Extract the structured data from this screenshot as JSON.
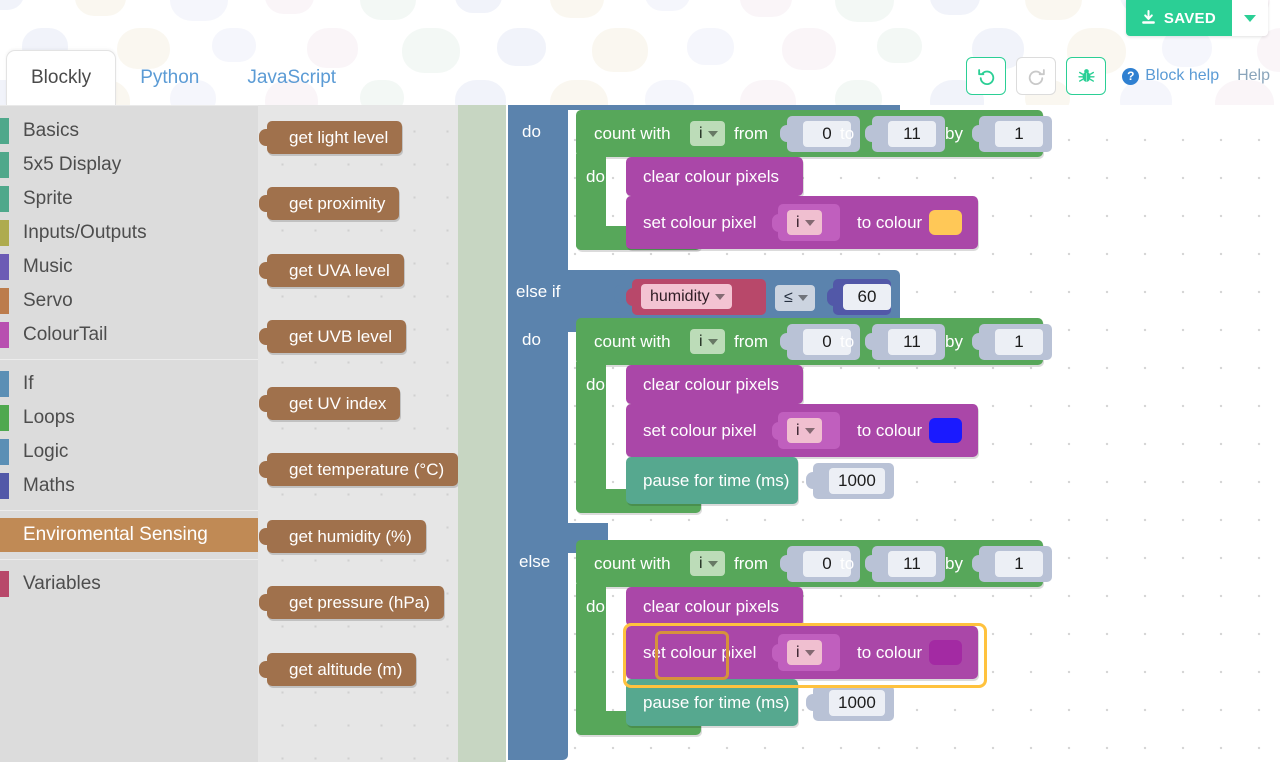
{
  "header": {
    "tabs": [
      {
        "label": "Blockly",
        "active": true
      },
      {
        "label": "Python",
        "active": false
      },
      {
        "label": "JavaScript",
        "active": false
      }
    ],
    "save_button": {
      "label": "SAVED",
      "icon": "download-icon",
      "color": "#2bcf95"
    },
    "save_dropdown_icon": "chevron-down-icon",
    "toolbar": [
      {
        "name": "undo-button",
        "icon": "undo-icon",
        "enabled": true
      },
      {
        "name": "redo-button",
        "icon": "redo-icon",
        "enabled": false
      },
      {
        "name": "debug-button",
        "icon": "bug-icon",
        "enabled": true
      }
    ],
    "block_help_label": "Block help",
    "help_label": "Help"
  },
  "toolbox": {
    "groups": [
      [
        {
          "label": "Basics",
          "color": "#4fa88b"
        },
        {
          "label": "5x5 Display",
          "color": "#4fa88b"
        },
        {
          "label": "Sprite",
          "color": "#4fa88b"
        },
        {
          "label": "Inputs/Outputs",
          "color": "#aeab4e"
        },
        {
          "label": "Music",
          "color": "#6c5bb5"
        },
        {
          "label": "Servo",
          "color": "#bc7c4c"
        },
        {
          "label": "ColourTail",
          "color": "#b84fb0"
        }
      ],
      [
        {
          "label": "If",
          "color": "#5b8fb5"
        },
        {
          "label": "Loops",
          "color": "#4fa84f"
        },
        {
          "label": "Logic",
          "color": "#5b8fb5"
        },
        {
          "label": "Maths",
          "color": "#5258a8"
        }
      ],
      [
        {
          "label": "Enviromental Sensing",
          "color": "#c08a55",
          "selected": true
        }
      ],
      [
        {
          "label": "Variables",
          "color": "#b8486a"
        }
      ]
    ]
  },
  "flyout": {
    "block_color": "#a0714c",
    "blocks": [
      {
        "label": "get light level"
      },
      {
        "label": "get proximity"
      },
      {
        "label": "get UVA level"
      },
      {
        "label": "get UVB level"
      },
      {
        "label": "get UV index"
      },
      {
        "label": "get temperature (°C)"
      },
      {
        "label": "get humidity (%)"
      },
      {
        "label": "get pressure (hPa)"
      },
      {
        "label": "get altitude (m)"
      }
    ]
  },
  "workspace": {
    "if_block": {
      "color": "#5b83ad",
      "branch1_label": "do",
      "elseif_label": "else if",
      "branch2_label": "do",
      "else_label": "else",
      "condition": {
        "variable": "humidity",
        "operator": "≤",
        "value": "60"
      }
    },
    "loop": {
      "color": "#57a75a",
      "count_with": "count with",
      "var": "i",
      "from_label": "from",
      "from_value": "0",
      "to_label": "to",
      "to_value": "11",
      "by_label": "by",
      "by_value": "1",
      "do_label": "do"
    },
    "colourtail": {
      "color": "#aa47a8",
      "clear_label": "clear colour pixels",
      "set_label": "set colour pixel",
      "set_var": "i",
      "to_colour_label": "to colour"
    },
    "pause": {
      "color": "#56a88f",
      "label": "pause for time (ms)",
      "value": "1000"
    },
    "branches": [
      {
        "colour_swatch": "#ffc857",
        "has_pause": false
      },
      {
        "colour_swatch": "#1a1aff",
        "has_pause": true
      },
      {
        "colour_swatch": "#a32aa3",
        "has_pause": true,
        "selected": true
      }
    ]
  }
}
